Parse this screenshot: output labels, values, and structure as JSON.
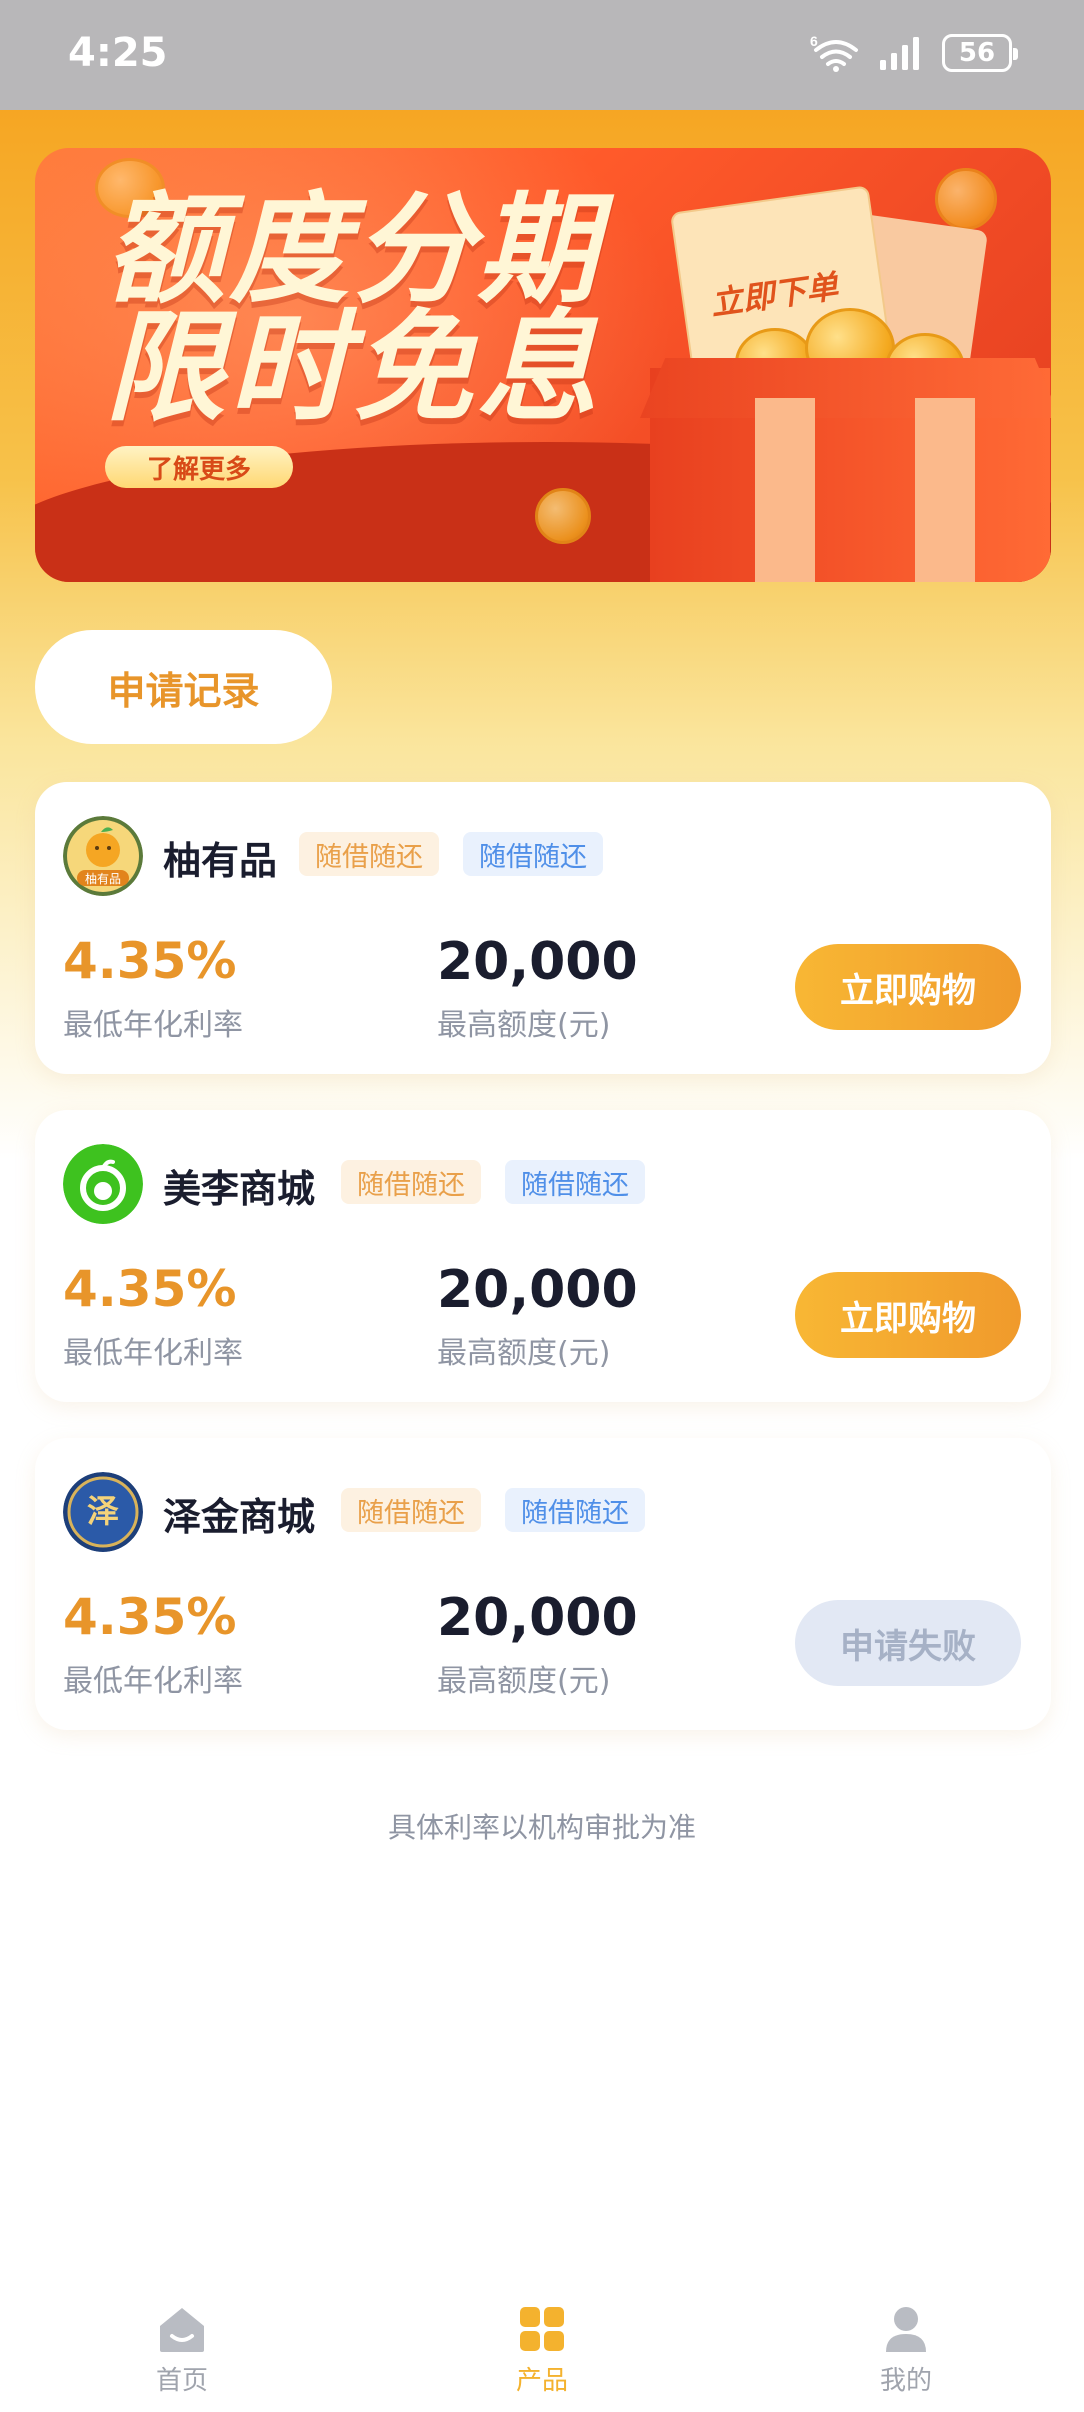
{
  "status_bar": {
    "time": "4:25",
    "network_superscript": "6",
    "battery": "56"
  },
  "banner": {
    "title_line1": "额度分期",
    "title_line2": "限时免息",
    "button": "了解更多",
    "ticket_text": "立即下单"
  },
  "records_button": "申请记录",
  "products": [
    {
      "name": "柚有品",
      "logo_text": "柚有品",
      "tags": [
        "随借随还",
        "随借随还"
      ],
      "rate": "4.35%",
      "rate_label": "最低年化利率",
      "amount": "20,000",
      "amount_label": "最高额度(元)",
      "action": "立即购物",
      "status": "active"
    },
    {
      "name": "美李商城",
      "tags": [
        "随借随还",
        "随借随还"
      ],
      "rate": "4.35%",
      "rate_label": "最低年化利率",
      "amount": "20,000",
      "amount_label": "最高额度(元)",
      "action": "立即购物",
      "status": "active"
    },
    {
      "name": "泽金商城",
      "logo_text": "泽",
      "tags": [
        "随借随还",
        "随借随还"
      ],
      "rate": "4.35%",
      "rate_label": "最低年化利率",
      "amount": "20,000",
      "amount_label": "最高额度(元)",
      "action": "申请失败",
      "status": "failed"
    }
  ],
  "footnote": "具体利率以机构审批为准",
  "tabbar": [
    {
      "label": "首页",
      "icon": "home-icon",
      "active": false
    },
    {
      "label": "产品",
      "icon": "grid-icon",
      "active": true
    },
    {
      "label": "我的",
      "icon": "user-icon",
      "active": false
    }
  ],
  "colors": {
    "accent": "#F0A030",
    "primary_text": "#1A1D2E",
    "secondary_text": "#8F95A3",
    "tag_orange": "#E9A04A",
    "tag_blue": "#4F8FE8",
    "failed_button": "#E2E8F4"
  }
}
